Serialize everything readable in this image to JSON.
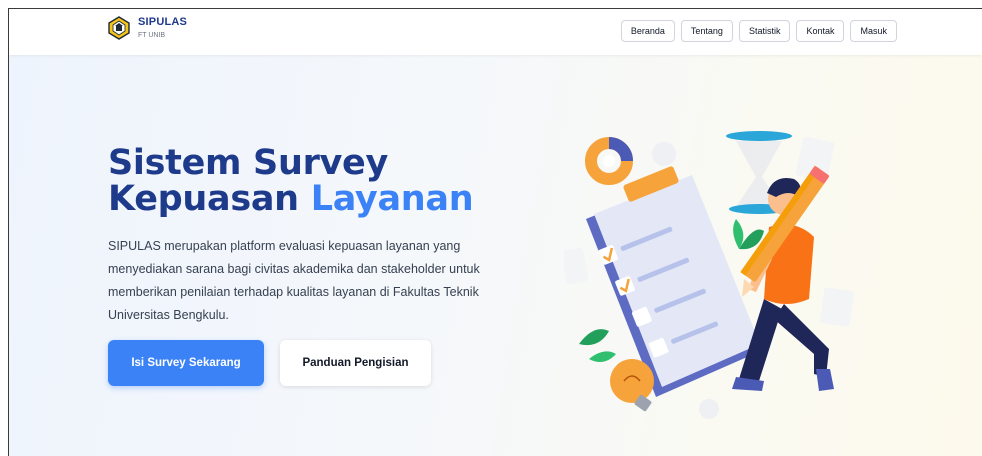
{
  "header": {
    "brand_title": "SIPULAS",
    "brand_sub": "FT UNIB",
    "nav": [
      "Beranda",
      "Tentang",
      "Statistik",
      "Kontak",
      "Masuk"
    ]
  },
  "hero": {
    "title_line1": "Sistem Survey",
    "title_line2_a": "Kepuasan ",
    "title_line2_b": "Layanan",
    "description": "SIPULAS merupakan platform evaluasi kepuasan layanan yang menyediakan sarana bagi civitas akademika dan stakeholder untuk memberikan penilaian terhadap kualitas layanan di Fakultas Teknik Universitas Bengkulu.",
    "primary_button": "Isi Survey Sekarang",
    "secondary_button": "Panduan Pengisian"
  },
  "colors": {
    "brand_dark": "#1e3a8a",
    "accent": "#3b82f6",
    "illustration_orange": "#f97316"
  },
  "icons": {
    "logo": "university-emblem-icon",
    "illustration": "survey-clipboard-illustration"
  }
}
